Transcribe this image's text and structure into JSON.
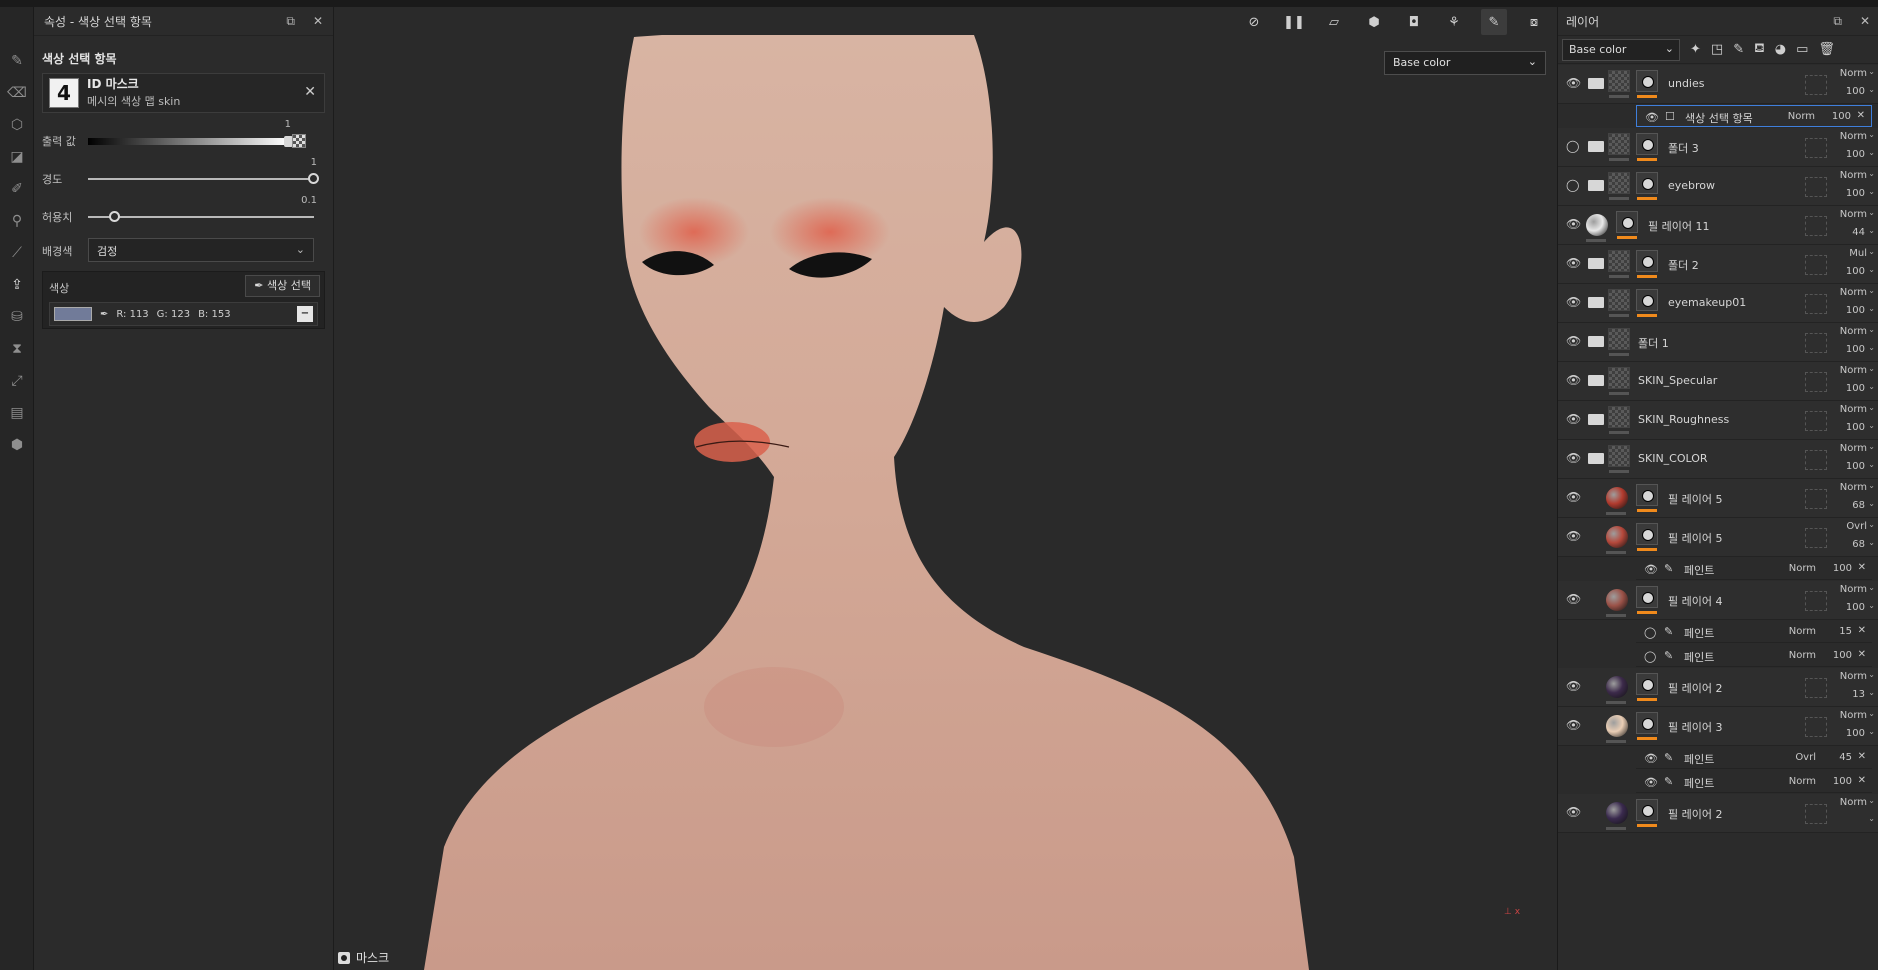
{
  "properties": {
    "title": "속성 - 색상 선택 항목",
    "section_title": "색상 선택 항목",
    "id_mask": {
      "thumb_text": "4",
      "title": "ID 마스크",
      "subtitle": "메시의 색상 맵 skin"
    },
    "output": {
      "label": "출력 값",
      "value": "1",
      "fraction": 1.0
    },
    "hardness": {
      "label": "경도",
      "value": "1",
      "fraction": 1.0
    },
    "tolerance": {
      "label": "허용치",
      "value": "0.1",
      "fraction": 0.1
    },
    "background": {
      "label": "배경색",
      "value": "검정"
    },
    "color": {
      "label": "색상",
      "pick_label": "색상 선택",
      "swatch": "#717b99",
      "r": "R: 113",
      "g": "G: 123",
      "b": "B: 153"
    }
  },
  "viewport": {
    "channel": "Base color",
    "mask_label": "마스크"
  },
  "layers_panel": {
    "title": "레이어",
    "channel": "Base color",
    "layers": [
      {
        "name": "undies",
        "blend": "Norm",
        "opacity": "100",
        "kind": "folder",
        "visible": true
      },
      {
        "name": "폴더 3",
        "blend": "Norm",
        "opacity": "100",
        "kind": "folder",
        "visible": false
      },
      {
        "name": "eyebrow",
        "blend": "Norm",
        "opacity": "100",
        "kind": "folder",
        "visible": false
      },
      {
        "name": "필 레이어 11",
        "blend": "Norm",
        "opacity": "44",
        "kind": "fill",
        "visible": true
      },
      {
        "name": "폴더 2",
        "blend": "Mul",
        "opacity": "100",
        "kind": "folder",
        "visible": true
      },
      {
        "name": "eyemakeup01",
        "blend": "Norm",
        "opacity": "100",
        "kind": "folder",
        "visible": true
      },
      {
        "name": "폴더 1",
        "blend": "Norm",
        "opacity": "100",
        "kind": "folder",
        "visible": true
      },
      {
        "name": "SKIN_Specular",
        "blend": "Norm",
        "opacity": "100",
        "kind": "folder",
        "visible": true
      },
      {
        "name": "SKIN_Roughness",
        "blend": "Norm",
        "opacity": "100",
        "kind": "folder",
        "visible": true
      },
      {
        "name": "SKIN_COLOR",
        "blend": "Norm",
        "opacity": "100",
        "kind": "folder",
        "visible": true
      },
      {
        "name": "필 레이어 5",
        "blend": "Norm",
        "opacity": "68",
        "kind": "fill",
        "visible": true
      },
      {
        "name": "필 레이어 5",
        "blend": "Ovrl",
        "opacity": "68",
        "kind": "fill",
        "visible": true
      },
      {
        "name": "필 레이어 4",
        "blend": "Norm",
        "opacity": "100",
        "kind": "fill",
        "visible": true
      },
      {
        "name": "필 레이어 2",
        "blend": "Norm",
        "opacity": "13",
        "kind": "fill",
        "visible": true
      },
      {
        "name": "필 레이어 3",
        "blend": "Norm",
        "opacity": "100",
        "kind": "fill",
        "visible": true
      },
      {
        "name": "필 레이어 2",
        "blend": "Norm",
        "opacity": "",
        "kind": "fill",
        "visible": true
      }
    ],
    "effects": [
      {
        "name": "색상 선택 항목",
        "blend": "Norm",
        "opacity": "100",
        "parent": 0
      },
      {
        "name": "페인트",
        "blend": "Norm",
        "opacity": "100",
        "parent": 11
      },
      {
        "name": "페인트",
        "blend": "Norm",
        "opacity": "15",
        "parent": 12
      },
      {
        "name": "페인트",
        "blend": "Norm",
        "opacity": "100",
        "parent": 12
      },
      {
        "name": "페인트",
        "blend": "Ovrl",
        "opacity": "45",
        "parent": 14
      },
      {
        "name": "페인트",
        "blend": "Norm",
        "opacity": "100",
        "parent": 14
      }
    ]
  }
}
